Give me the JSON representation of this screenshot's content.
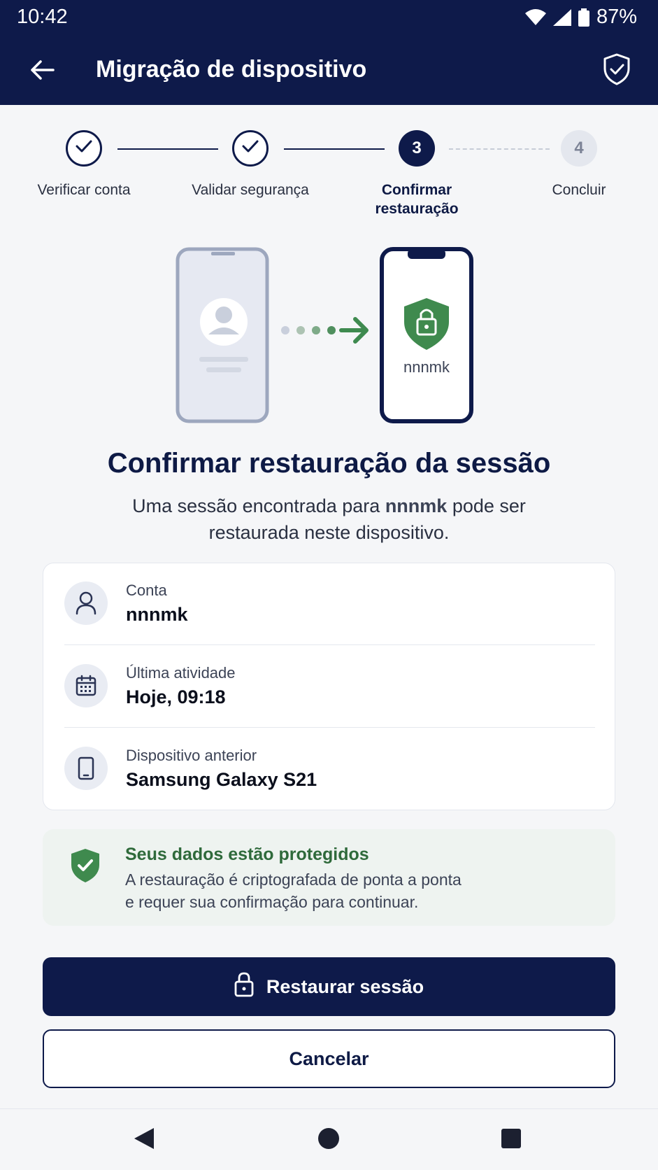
{
  "status_bar": {
    "time": "10:42",
    "battery": "87%"
  },
  "app_bar": {
    "title": "Migração de dispositivo"
  },
  "stepper": {
    "steps": [
      {
        "number": "1",
        "label": "Verificar conta",
        "state": "done"
      },
      {
        "number": "2",
        "label": "Validar segurança",
        "state": "done"
      },
      {
        "number": "3",
        "label_line1": "Confirmar",
        "label_line2": "restauração",
        "state": "current"
      },
      {
        "number": "4",
        "label": "Concluir",
        "state": "pending"
      }
    ]
  },
  "illustration": {
    "target_username": "nnnmk"
  },
  "headline": "Confirmar restauração da sessão",
  "subline": {
    "before": "Uma sessão encontrada para ",
    "username": "nnnmk",
    "after": " pode ser restaurada neste dispositivo."
  },
  "details": [
    {
      "label": "Conta",
      "value": "nnnmk",
      "icon": "user-icon"
    },
    {
      "label": "Última atividade",
      "value": "Hoje, 09:18",
      "icon": "calendar-icon"
    },
    {
      "label": "Dispositivo anterior",
      "value": "Samsung Galaxy S21",
      "icon": "phone-icon"
    }
  ],
  "notice": {
    "title": "Seus dados estão protegidos",
    "line1": "A restauração é criptografada de ponta a ponta",
    "line2": "e requer sua confirmação para continuar."
  },
  "actions": {
    "primary": "Restaurar sessão",
    "secondary": "Cancelar"
  },
  "colors": {
    "brand": "#0E1A4A",
    "success": "#2F6A3B",
    "success_bg": "#EEF3F0"
  }
}
